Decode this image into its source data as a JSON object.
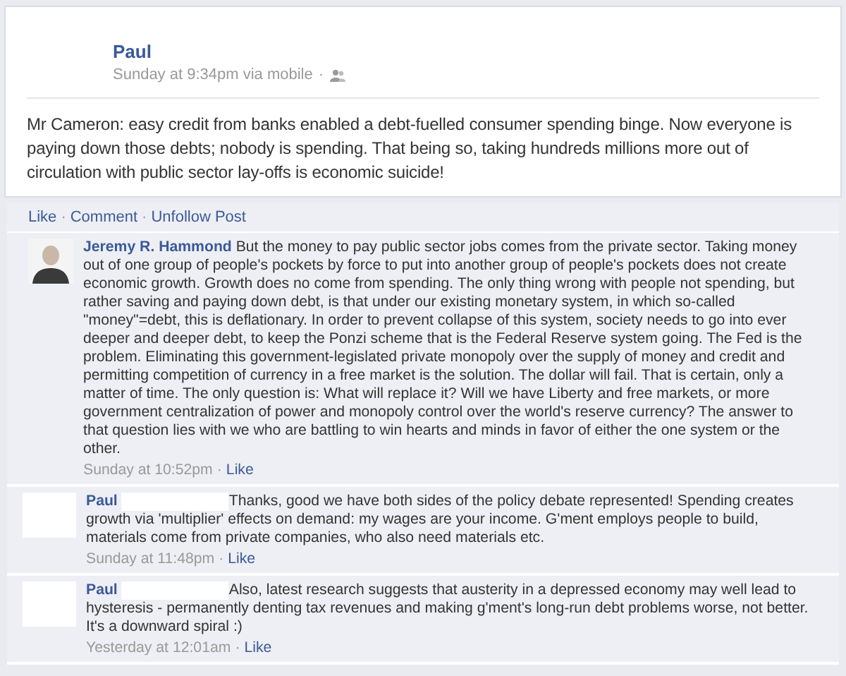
{
  "post": {
    "author": "Paul",
    "time": "Sunday at 9:34pm via mobile",
    "separator": "·",
    "text": "Mr Cameron: easy credit from banks enabled a debt-fuelled consumer spending binge. Now everyone is paying down those debts; nobody is spending. That being so, taking hundreds millions more out of circulation with public sector lay-offs is economic suicide!"
  },
  "actions": [
    {
      "label": "Like"
    },
    {
      "label": "Comment"
    },
    {
      "label": "Unfollow Post"
    }
  ],
  "action_separator": "·",
  "comments": [
    {
      "author": "Jeremy R. Hammond",
      "kind": "photo",
      "name_hidden": false,
      "text": "But the money to pay public sector jobs comes from the private sector. Taking money out of one group of people's pockets by force to put into another group of people's pockets does not create economic growth. Growth does no come from spending. The only thing wrong with people not spending, but rather saving and paying down debt, is that under our existing monetary system, in which so-called \"money\"=debt, this is deflationary. In order to prevent collapse of this system, society needs to go into ever deeper and deeper debt, to keep the Ponzi scheme that is the Federal Reserve system going. The Fed is the problem. Eliminating this government-legislated private monopoly over the supply of money and credit and permitting competition of currency in a free market is the solution. The dollar will fail. That is certain, only a matter of time. The only question is: What will replace it? Will we have Liberty and free markets, or more government centralization of power and monopoly control over the world's reserve currency? The answer to that question lies with we who are battling to win hearts and minds in favor of either the one system or the other.",
      "time": "Sunday at 10:52pm",
      "separator": "·",
      "like": "Like"
    },
    {
      "author": "Paul",
      "kind": "hidden",
      "name_hidden": true,
      "text": "Thanks, good we have both sides of the policy debate represented! Spending creates growth via 'multiplier' effects on demand: my wages are your income. G'ment employs people to build, materials come from private companies, who also need materials etc.",
      "time": "Sunday at 11:48pm",
      "separator": "·",
      "like": "Like"
    },
    {
      "author": "Paul",
      "kind": "hidden",
      "name_hidden": true,
      "text": "Also, latest research suggests that austerity in a depressed economy may well lead to hysteresis - permanently denting tax revenues and making g'ment's long-run debt problems worse, not better. It's a downward spiral :)",
      "time": "Yesterday at 12:01am",
      "separator": "·",
      "like": "Like"
    }
  ]
}
